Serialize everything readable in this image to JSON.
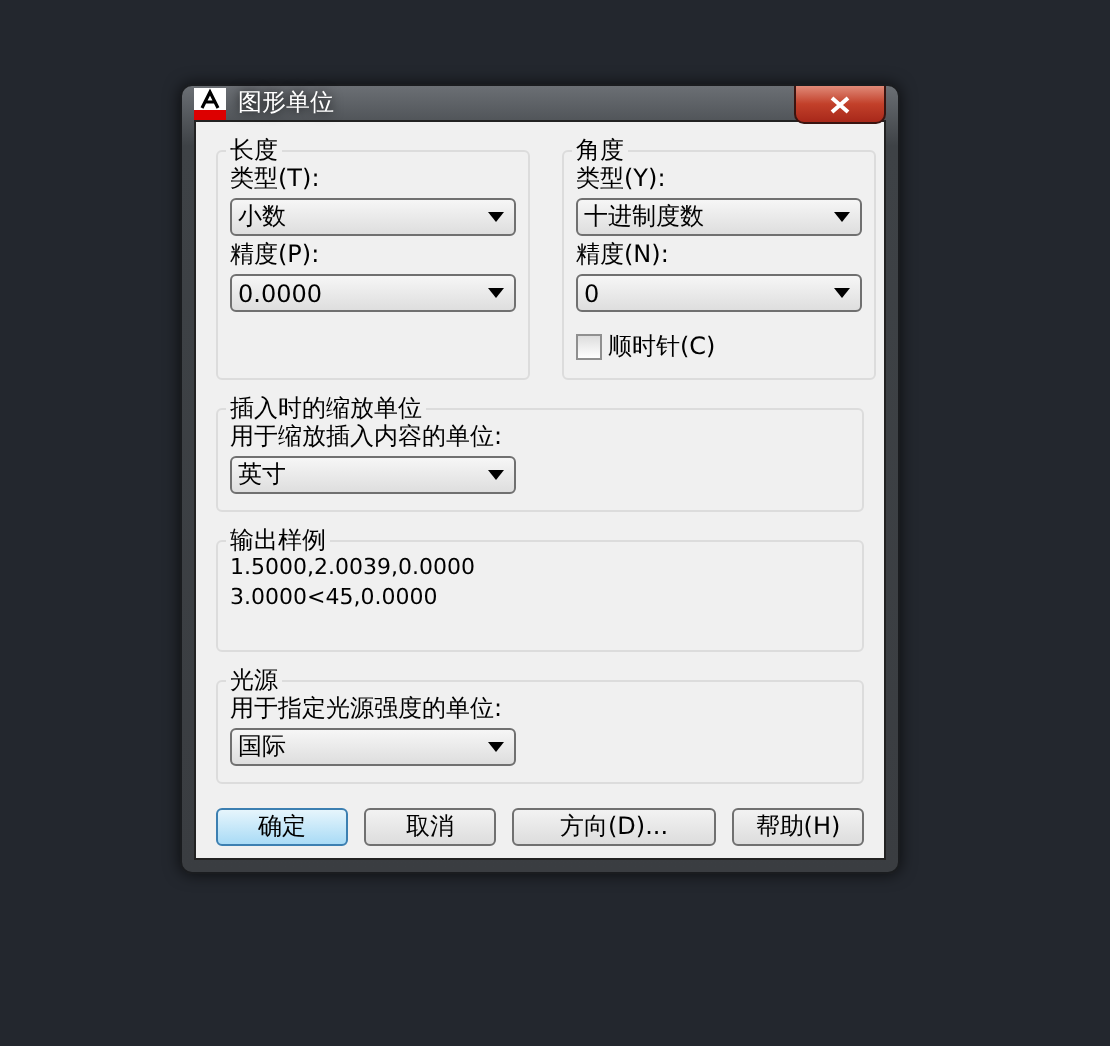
{
  "window": {
    "title": "图形单位"
  },
  "length": {
    "title": "长度",
    "type_label": "类型(T):",
    "type_value": "小数",
    "precision_label": "精度(P):",
    "precision_value": "0.0000"
  },
  "angle": {
    "title": "角度",
    "type_label": "类型(Y):",
    "type_value": "十进制度数",
    "precision_label": "精度(N):",
    "precision_value": "0",
    "clockwise": {
      "label": "顺时针(C)",
      "checked": false
    }
  },
  "insert_scale": {
    "title": "插入时的缩放单位",
    "label": "用于缩放插入内容的单位:",
    "value": "英寸"
  },
  "sample_output": {
    "title": "输出样例",
    "lines": [
      "1.5000,2.0039,0.0000",
      "3.0000<45,0.0000"
    ]
  },
  "lighting": {
    "title": "光源",
    "label": "用于指定光源强度的单位:",
    "value": "国际"
  },
  "buttons": [
    {
      "label": "确定",
      "selected": true
    },
    {
      "label": "取消",
      "selected": false
    },
    {
      "label": "方向(D)...",
      "selected": false
    },
    {
      "label": "帮助(H)",
      "selected": false
    }
  ]
}
